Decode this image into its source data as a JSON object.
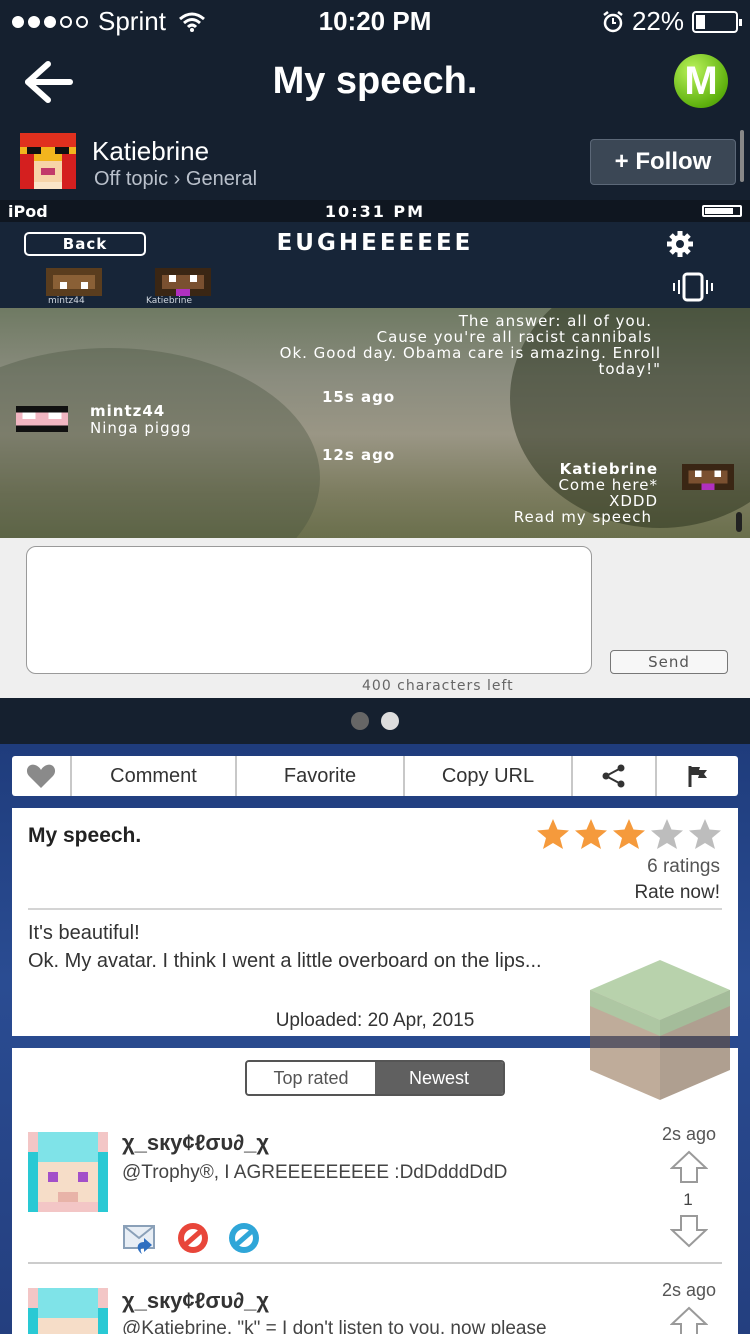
{
  "status_bar": {
    "carrier": "Sprint",
    "time": "10:20 PM",
    "battery": "22%"
  },
  "nav": {
    "title": "My speech.",
    "logo_letter": "M"
  },
  "author": {
    "name": "Katiebrine",
    "category": "Off topic › General",
    "follow_label": "+ Follow"
  },
  "screenshot": {
    "device_label": "iPod",
    "time": "10:31 PM",
    "back_label": "Back",
    "room_title": "EUGHEEEEEE",
    "participants": [
      "mintz44",
      "Katiebrine"
    ],
    "chat_lines": [
      "The answer: all of you.",
      "Cause you're all racist cannibals",
      "Ok. Good day. Obama care is amazing. Enroll",
      "today!\""
    ],
    "time_1": "15s ago",
    "msg_1_user": "mintz44",
    "msg_1_text": "Ninga piggg",
    "time_2": "12s ago",
    "msg_2_user": "Katiebrine",
    "msg_2_lines": [
      "Come here*",
      "XDDD",
      "Read my speech"
    ],
    "send_label": "Send",
    "chars_left": "400 characters left"
  },
  "actions": {
    "comment": "Comment",
    "favorite": "Favorite",
    "copy_url": "Copy URL"
  },
  "post": {
    "title": "My speech.",
    "rating_stars": 3,
    "ratings_count": "6 ratings",
    "rate_now": "Rate now!",
    "description_line1": "It's beautiful!",
    "description_line2": "Ok. My avatar. I think I went a little overboard on the lips...",
    "uploaded": "Uploaded: 20 Apr, 2015"
  },
  "comments": {
    "tab_top": "Top rated",
    "tab_newest": "Newest",
    "items": [
      {
        "user": "χ_ѕку¢ℓσυ∂_χ",
        "text": "@Trophy®, I AGREEEEEEEEE :DdDdddDdD",
        "time": "2s ago",
        "votes": "1"
      },
      {
        "user": "χ_ѕку¢ℓσυ∂_χ",
        "text": "@Katiebrine, \"k\" = I don't listen to you, now please",
        "time": "2s ago"
      }
    ]
  },
  "colors": {
    "dark_bar": "#15202f",
    "blue_bg": "#25428a",
    "star_on": "#f59a3c",
    "star_off": "#bdbdbd",
    "logo_green": "#5fb10e"
  }
}
